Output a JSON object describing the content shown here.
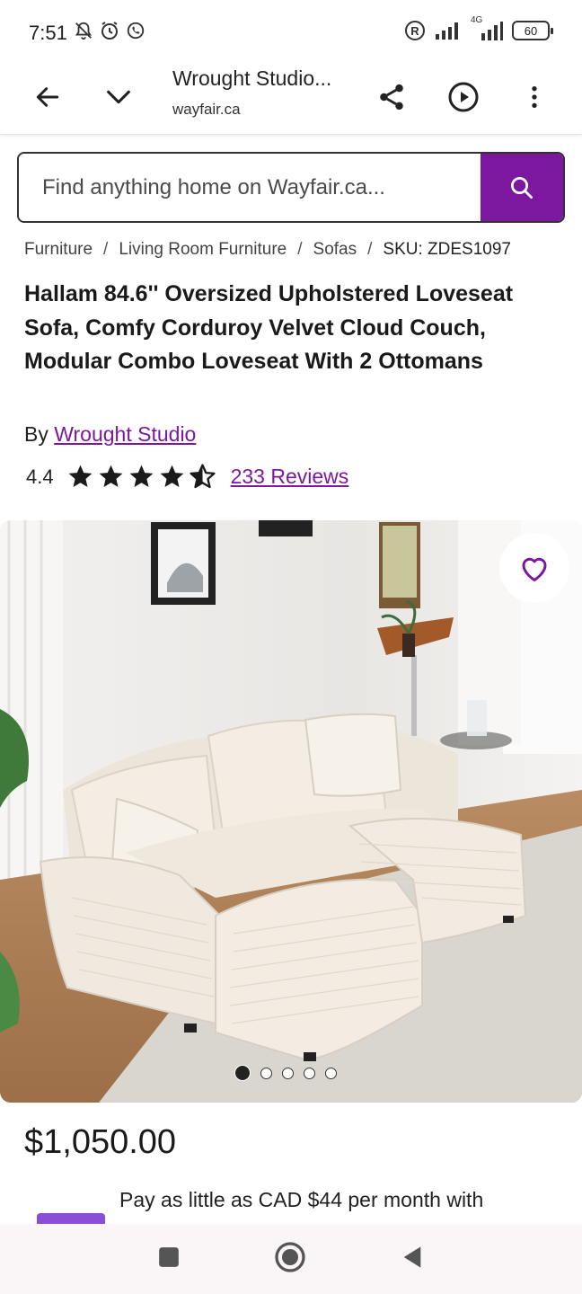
{
  "status_bar": {
    "time": "7:51",
    "network": "4G",
    "battery": "60"
  },
  "browser": {
    "title": "Wrought Studio...",
    "url": "wayfair.ca"
  },
  "search": {
    "placeholder": "Find anything home on Wayfair.ca..."
  },
  "breadcrumb": {
    "items": [
      "Furniture",
      "Living Room Furniture",
      "Sofas"
    ],
    "sku": "SKU: ZDES1097"
  },
  "product": {
    "title": "Hallam 84.6'' Oversized Upholstered Loveseat Sofa, Comfy Corduroy Velvet Cloud Couch, Modular Combo Loveseat With 2 Ottomans",
    "by_prefix": "By",
    "brand": "Wrought Studio",
    "rating": "4.4",
    "rating_value": 4.4,
    "reviews": "233 Reviews",
    "price": "$1,050.00",
    "financing": "Pay as little as CAD $44 per month with"
  },
  "gallery": {
    "image_count": 5,
    "active_index": 0
  },
  "colors": {
    "accent": "#7b189f",
    "text": "#1a1a1a"
  }
}
